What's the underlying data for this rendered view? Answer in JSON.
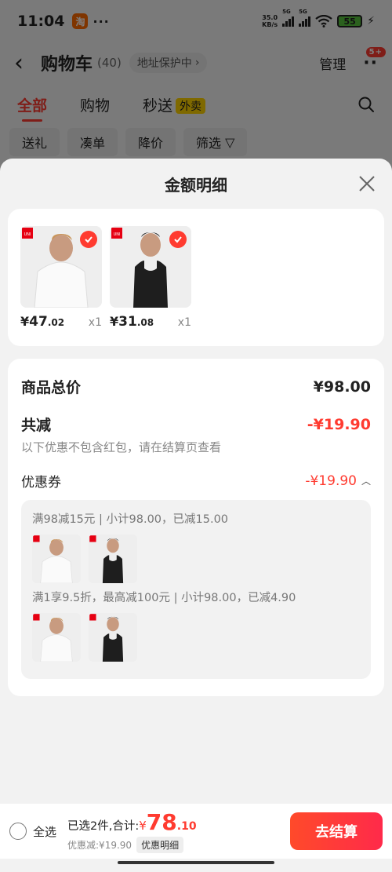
{
  "status_bar": {
    "time": "11:04",
    "app_badge": "淘",
    "more": "···",
    "net_speed_value": "35.0",
    "net_speed_unit": "KB/s",
    "signal_1": "5G",
    "signal_2": "5G",
    "battery": "55"
  },
  "nav": {
    "title": "购物车",
    "count": "(40)",
    "address_protect": "地址保护中",
    "manage": "管理",
    "message_badge": "5+"
  },
  "tabs": [
    {
      "label": "全部",
      "active": true
    },
    {
      "label": "购物",
      "active": false
    },
    {
      "label": "秒送",
      "badge": "外卖",
      "active": false
    }
  ],
  "filters": [
    "送礼",
    "凑单",
    "降价",
    "筛选"
  ],
  "sheet": {
    "title": "金额明细",
    "products": [
      {
        "brand": "UNIQLO",
        "price_symbol": "¥",
        "price_int": "47",
        "price_dec": ".02",
        "qty": "x1",
        "icon": "white-tshirt"
      },
      {
        "brand": "UNIQLO",
        "price_symbol": "¥",
        "price_int": "31",
        "price_dec": ".08",
        "qty": "x1",
        "icon": "black-tanktop"
      }
    ],
    "total_label": "商品总价",
    "total_value": "¥98.00",
    "reduce_label": "共减",
    "reduce_value": "-¥19.90",
    "reduce_note": "以下优惠不包含红包，请在结算页查看",
    "coupon_label": "优惠券",
    "coupon_value": "-¥19.90",
    "promotions": [
      {
        "title": "满98减15元 | 小计98.00，已减15.00"
      },
      {
        "title": "满1享9.5折，最高减100元 | 小计98.00，已减4.90"
      }
    ]
  },
  "bottom_bar": {
    "select_all": "全选",
    "summary_prefix": "已选2件,合计:",
    "total_symbol": "¥",
    "total_int": "78",
    "total_dec": ".10",
    "discount_text": "优惠减:¥19.90",
    "detail_button": "优惠明细",
    "checkout_button": "去结算"
  },
  "colors": {
    "accent": "#ff3b30",
    "checkout": "#ff3b3b",
    "badge_yellow": "#ffd200"
  }
}
